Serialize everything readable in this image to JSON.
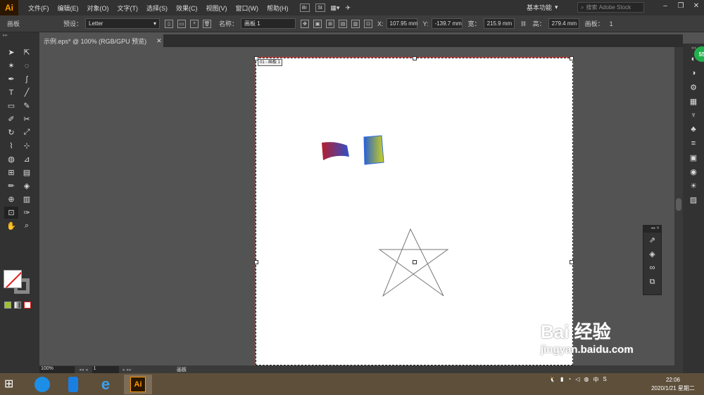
{
  "app": {
    "logo": "Ai"
  },
  "menu": [
    "文件(F)",
    "编辑(E)",
    "对象(O)",
    "文字(T)",
    "选择(S)",
    "效果(C)",
    "视图(V)",
    "窗口(W)",
    "帮助(H)"
  ],
  "toolbar_icons": {
    "br": "Br",
    "st": "St"
  },
  "workspace": {
    "label": "基本功能",
    "search_placeholder": "搜索 Adobe Stock"
  },
  "control": {
    "panel_label": "画板",
    "preset_label": "预设：",
    "preset_value": "Letter",
    "name_label": "名称：",
    "name_value": "画板 1",
    "x_label": "X:",
    "x_value": "107.95 mm",
    "y_label": "Y:",
    "y_value": "-139.7 mm",
    "w_label": "宽：",
    "w_value": "215.9 mm",
    "h_label": "高：",
    "h_value": "279.4 mm",
    "artboards_label": "画板：",
    "artboards_value": "1"
  },
  "document": {
    "tab": "示例.eps* @ 100% (RGB/GPU 预览)",
    "artboard_label": "01 - 画板 1"
  },
  "status": {
    "zoom": "100%",
    "page": "1",
    "tool": "画板"
  },
  "float_panel_icons": [
    "export-icon",
    "layers-icon",
    "cc-libraries-icon",
    "artboards-icon"
  ],
  "watermark": {
    "line1": "Bai  经验",
    "line2": "jingyan.baidu.com",
    "badge": "55"
  },
  "taskbar": {
    "ai_label": "Ai"
  },
  "tray": {
    "ime": "中",
    "time": "22:06",
    "date": "2020/1/21 星期二"
  },
  "colors": {
    "accent": "#ff9a00",
    "artboard_border": "#d63232",
    "green_badge": "#21b04b"
  }
}
